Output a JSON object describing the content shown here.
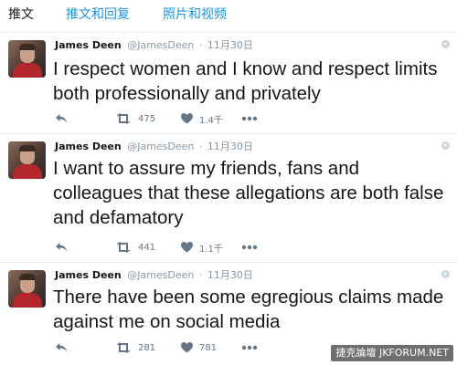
{
  "tabs": [
    {
      "label": "推文",
      "active": true
    },
    {
      "label": "推文和回复",
      "active": false
    },
    {
      "label": "照片和视频",
      "active": false
    }
  ],
  "tweets": [
    {
      "name": "James Deen",
      "handle": "@JamesDeen",
      "separator": "·",
      "date": "11月30日",
      "text": "I respect women and I know and respect limits both professionally and privately",
      "retweets": "475",
      "likes": "1.4千"
    },
    {
      "name": "James Deen",
      "handle": "@JamesDeen",
      "separator": "·",
      "date": "11月30日",
      "text": "I want to assure my friends, fans and colleagues that these allegations are both false and defamatory",
      "retweets": "441",
      "likes": "1.1千"
    },
    {
      "name": "James Deen",
      "handle": "@JamesDeen",
      "separator": "·",
      "date": "11月30日",
      "text": "There have been some egregious claims made against me on social media",
      "retweets": "281",
      "likes": "781"
    }
  ],
  "icons": {
    "reply": "reply-icon",
    "retweet": "retweet-icon",
    "like": "heart-icon",
    "more": "more-icon",
    "caret": "caret-down-icon"
  },
  "colors": {
    "tab_link": "#1b95e0",
    "muted": "#8899a6",
    "action": "#657786",
    "divider": "#e6ecf0",
    "avatar_shirt": "#b3262b"
  },
  "watermark": "捷克論壇 JKFORUM.NET"
}
